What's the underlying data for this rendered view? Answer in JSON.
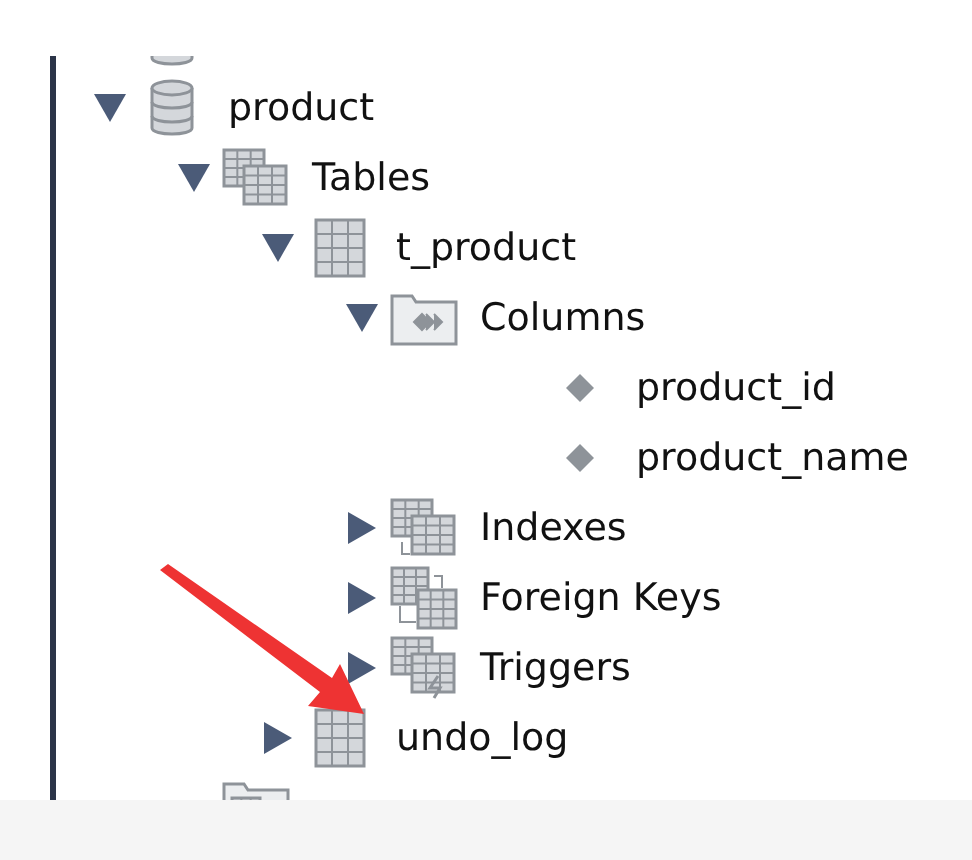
{
  "tree": [
    {
      "kind": "database"
    },
    {
      "kind": "database",
      "label": "product",
      "expanded": true,
      "children": [
        {
          "kind": "tables-folder",
          "label": "Tables",
          "expanded": true,
          "children": [
            {
              "kind": "table",
              "label": "t_product",
              "expanded": true,
              "children": [
                {
                  "kind": "columns-folder",
                  "label": "Columns",
                  "expanded": true,
                  "children": [
                    {
                      "kind": "column",
                      "label": "product_id"
                    },
                    {
                      "kind": "column",
                      "label": "product_name"
                    }
                  ]
                },
                {
                  "kind": "indexes-folder",
                  "label": "Indexes",
                  "expanded": false
                },
                {
                  "kind": "keys-folder",
                  "label": "Foreign Keys",
                  "expanded": false
                },
                {
                  "kind": "triggers-folder",
                  "label": "Triggers",
                  "expanded": false
                }
              ]
            },
            {
              "kind": "table",
              "label": "undo_log",
              "expanded": false
            }
          ]
        },
        {
          "kind": "views-folder"
        }
      ]
    }
  ]
}
